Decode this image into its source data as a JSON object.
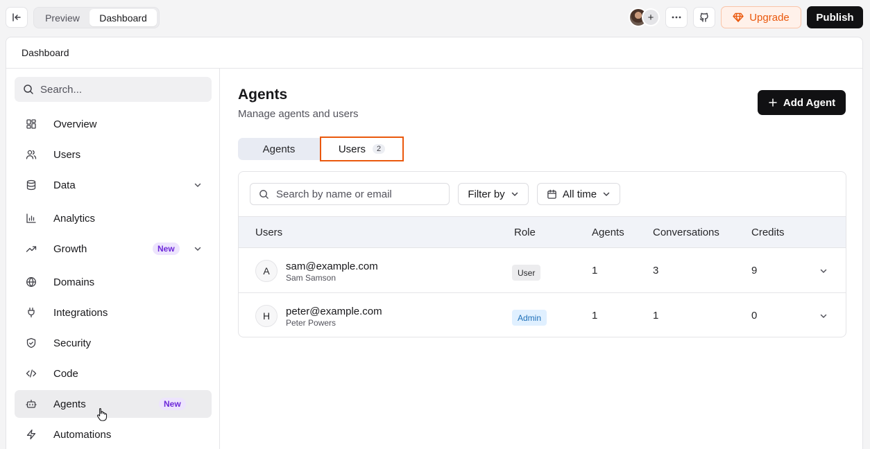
{
  "topbar": {
    "preview_label": "Preview",
    "dashboard_label": "Dashboard",
    "upgrade_label": "Upgrade",
    "publish_label": "Publish",
    "avatar_plus": "+"
  },
  "panel": {
    "header_title": "Dashboard"
  },
  "sidebar": {
    "search_placeholder": "Search...",
    "items": [
      {
        "label": "Overview",
        "icon": "grid-icon"
      },
      {
        "label": "Users",
        "icon": "users-icon"
      },
      {
        "label": "Data",
        "icon": "database-icon",
        "expandable": true
      },
      {
        "label": "Analytics",
        "icon": "bar-chart-icon"
      },
      {
        "label": "Growth",
        "icon": "trending-up-icon",
        "badge": "New",
        "expandable": true
      },
      {
        "label": "Domains",
        "icon": "globe-icon"
      },
      {
        "label": "Integrations",
        "icon": "plug-icon"
      },
      {
        "label": "Security",
        "icon": "shield-icon"
      },
      {
        "label": "Code",
        "icon": "code-icon"
      },
      {
        "label": "Agents",
        "icon": "bot-icon",
        "badge": "New",
        "active": true
      },
      {
        "label": "Automations",
        "icon": "zap-icon"
      }
    ]
  },
  "main": {
    "title": "Agents",
    "subtitle": "Manage agents and users",
    "add_agent_label": "Add Agent",
    "tabs": [
      {
        "label": "Agents"
      },
      {
        "label": "Users",
        "count": "2",
        "selected": true
      }
    ],
    "filters": {
      "search_placeholder": "Search by name or email",
      "filter_label": "Filter by",
      "time_label": "All time"
    },
    "table": {
      "columns": [
        "Users",
        "Role",
        "Agents",
        "Conversations",
        "Credits"
      ],
      "rows": [
        {
          "initial": "A",
          "email": "sam@example.com",
          "name": "Sam Samson",
          "role": "User",
          "agents": "1",
          "conversations": "3",
          "credits": "9"
        },
        {
          "initial": "H",
          "email": "peter@example.com",
          "name": "Peter Powers",
          "role": "Admin",
          "agents": "1",
          "conversations": "1",
          "credits": "0"
        }
      ]
    }
  },
  "colors": {
    "accent_orange": "#ea580c",
    "badge_purple": "#6d28d9",
    "primary_dark": "#111113",
    "admin_blue": "#1d6fb8"
  }
}
